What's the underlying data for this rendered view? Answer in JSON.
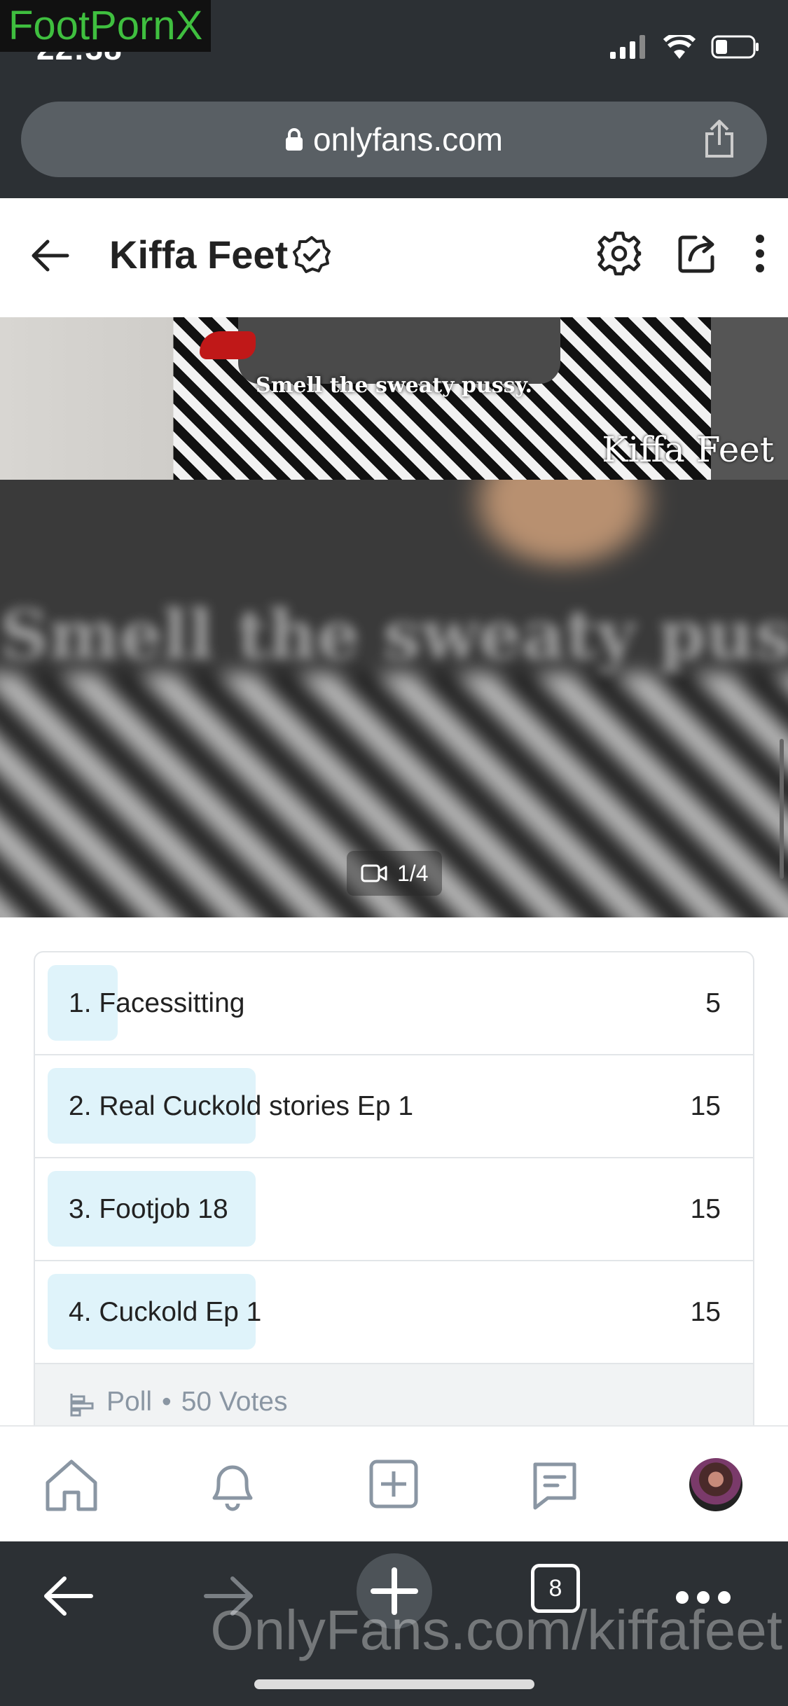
{
  "status_bar": {
    "time": "22:38"
  },
  "overlay_watermark_top": "FootPornX",
  "browser": {
    "url": "onlyfans.com",
    "tabs_count": "8"
  },
  "header": {
    "profile_name": "Kiffa Feet"
  },
  "media": {
    "caption": "Smell the sweaty pussy.",
    "brand": "Kiffa Feet",
    "counter": "1/4"
  },
  "poll": {
    "options": [
      {
        "label": "1. Facessitting",
        "count": "5",
        "share": 0.1
      },
      {
        "label": "2. Real Cuckold stories Ep 1",
        "count": "15",
        "share": 0.3
      },
      {
        "label": "3. Footjob 18",
        "count": "15",
        "share": 0.3
      },
      {
        "label": "4. Cuckold Ep 1",
        "count": "15",
        "share": 0.3
      }
    ],
    "footer_label": "Poll",
    "separator": "•",
    "votes": "50 Votes"
  },
  "overlay_watermark_bottom": "OnlyFans.com/kiffafeet",
  "colors": {
    "accent": "#00aff0",
    "poll_fill": "#dff3fa",
    "muted": "#8a96a3"
  }
}
